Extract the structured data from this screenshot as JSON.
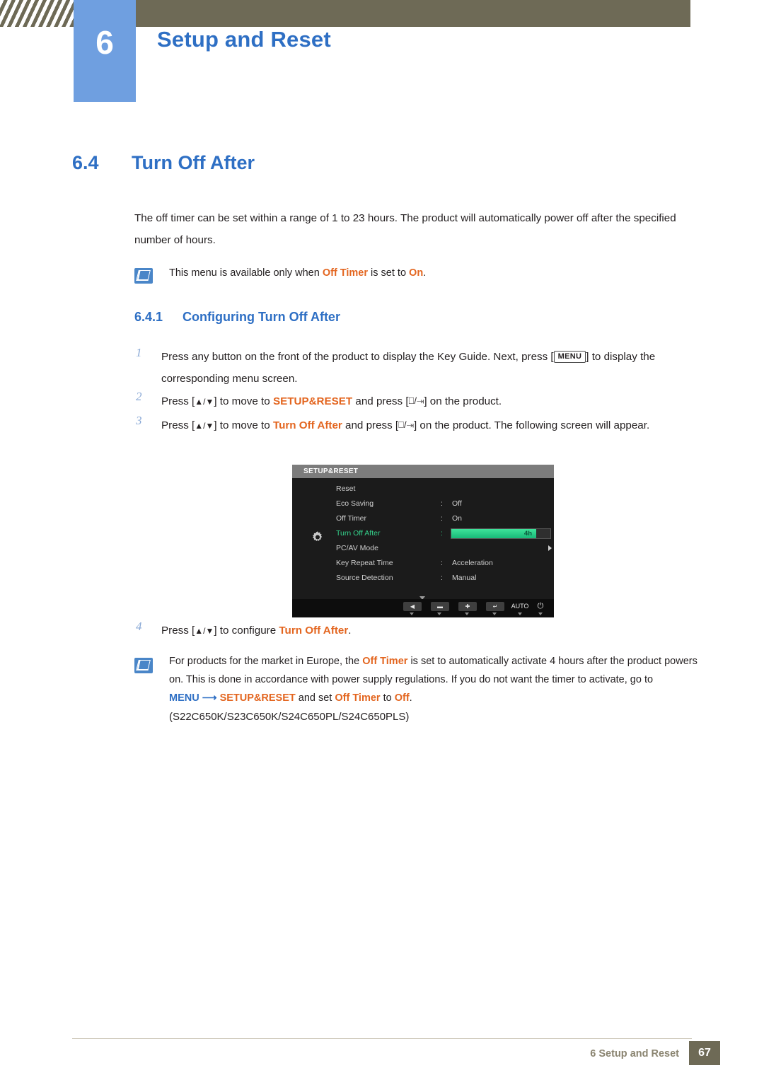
{
  "header": {
    "chapter_number": "6",
    "chapter_title": "Setup and Reset"
  },
  "section": {
    "number": "6.4",
    "title": "Turn Off After",
    "intro": "The off timer can be set within a range of 1 to 23 hours. The product will automatically power off after the specified number of hours."
  },
  "note1": {
    "icon": "note-icon",
    "prefix": "This menu is available only when ",
    "term1": "Off Timer",
    "middle": " is set to ",
    "term2": "On",
    "suffix": "."
  },
  "subsection": {
    "number": "6.4.1",
    "title": "Configuring Turn Off After"
  },
  "steps": [
    {
      "num": "1",
      "part1": "Press any button on the front of the product to display the Key Guide. Next, press [",
      "key": "MENU",
      "part2": "] to display the corresponding menu screen."
    },
    {
      "num": "2",
      "part1": "Press [",
      "keys": "▲/▼",
      "part2": "] to move to ",
      "term": "SETUP&RESET",
      "part3": " and press [",
      "part4": "] on the product."
    },
    {
      "num": "3",
      "part1": "Press [",
      "keys": "▲/▼",
      "part2": "] to move to ",
      "term": "Turn Off After",
      "part3": " and press [",
      "part4": "] on the product. The following screen will appear."
    },
    {
      "num": "4",
      "part1": "Press [",
      "keys": "▲/▼",
      "part2": "] to configure ",
      "term": "Turn Off After",
      "part3": "."
    }
  ],
  "osd": {
    "title": "SETUP&RESET",
    "rows": [
      {
        "label": "Reset",
        "colon": "",
        "value": ""
      },
      {
        "label": "Eco Saving",
        "colon": ":",
        "value": "Off"
      },
      {
        "label": "Off Timer",
        "colon": ":",
        "value": "On"
      },
      {
        "label": "Turn Off After",
        "colon": ":",
        "value": "4h",
        "selected": true,
        "bar": true
      },
      {
        "label": "PC/AV Mode",
        "colon": "",
        "value": "",
        "arrow": true
      },
      {
        "label": "Key Repeat Time",
        "colon": ":",
        "value": "Acceleration"
      },
      {
        "label": "Source Detection",
        "colon": ":",
        "value": "Manual"
      }
    ],
    "buttons": [
      "◀",
      "▬",
      "✚",
      "↵",
      "AUTO",
      "⏻"
    ],
    "auto_label": "AUTO"
  },
  "note2": {
    "icon": "note-icon",
    "line1a": "For products for the market in Europe, the ",
    "term1": "Off Timer",
    "line1b": " is set to automatically activate 4 hours after the",
    "line2": "product powers on. This is done in accordance with power supply regulations. If you do not want the",
    "line3a": "timer to activate, go to ",
    "term2": "MENU",
    "arrow": "⟶",
    "term3": "SETUP&RESET",
    "line3b": " and set ",
    "term4": "Off Timer",
    "line3c": " to ",
    "term5": "Off",
    "line3d": "."
  },
  "models": "(S22C650K/S23C650K/S24C650PL/S24C650PLS)",
  "footer": {
    "text": "6 Setup and Reset",
    "page": "67"
  },
  "colors": {
    "accent_blue": "#2e6fc4",
    "orange": "#e3651f",
    "chapter_box": "#6f9fe0",
    "header_bar": "#6e6a56",
    "osd_green": "#34d08a"
  }
}
